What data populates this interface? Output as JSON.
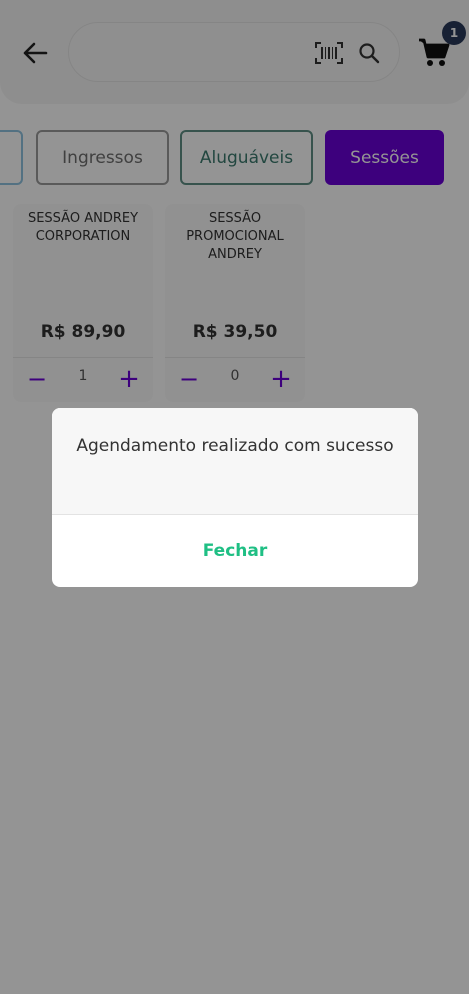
{
  "header": {
    "back_icon": "arrow-left-icon",
    "search": {
      "value": "",
      "placeholder": ""
    },
    "barcode_icon": "barcode-icon",
    "search_icon": "search-icon",
    "cart_icon": "cart-icon",
    "cart_count": "1"
  },
  "tabs": [
    {
      "label": ""
    },
    {
      "label": "Ingressos"
    },
    {
      "label": "Aluguáveis"
    },
    {
      "label": "Sessões",
      "selected": true
    }
  ],
  "products": [
    {
      "name": "SESSÃO ANDREY CORPORATION",
      "price": "R$ 89,90",
      "quantity": "1",
      "minus": "−",
      "plus": "+"
    },
    {
      "name": "SESSÃO PROMOCIONAL ANDREY",
      "price": "R$ 39,50",
      "quantity": "0",
      "minus": "−",
      "plus": "+"
    }
  ],
  "dialog": {
    "message": "Agendamento realizado com sucesso",
    "button_label": "Fechar"
  },
  "colors": {
    "accent": "#6a00d8",
    "success": "#1fbf84",
    "badge": "#2a3a5a",
    "overlay": "rgba(0,0,0,0.42)"
  }
}
